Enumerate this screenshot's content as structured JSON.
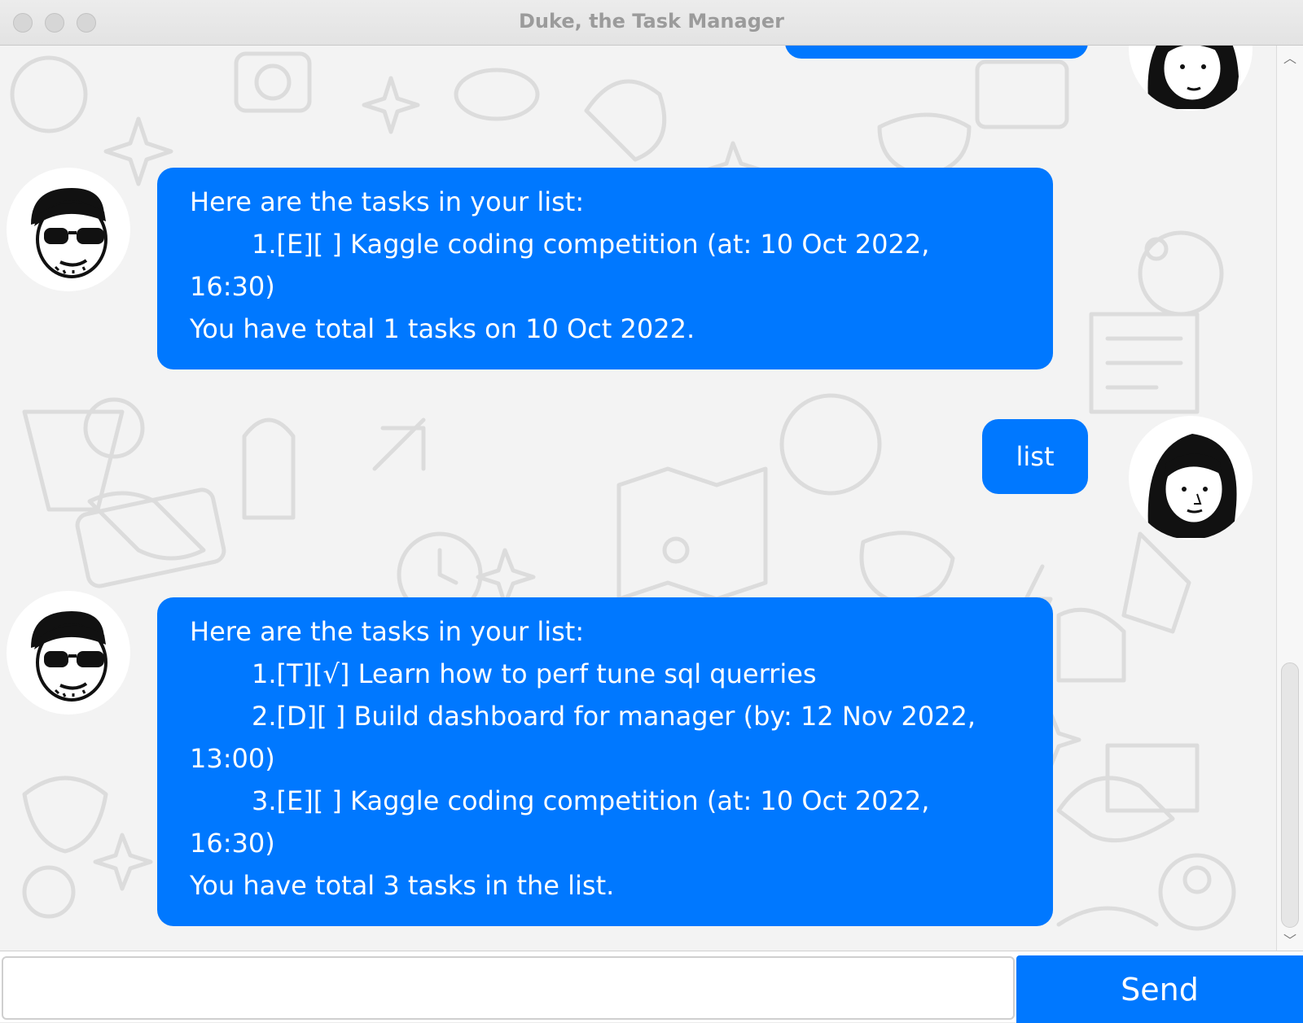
{
  "window": {
    "title": "Duke, the Task Manager"
  },
  "colors": {
    "accent": "#0078ff",
    "bubble_text": "#ffffff",
    "background": "#f3f3f3"
  },
  "messages": [
    {
      "from": "user",
      "text": ""
    },
    {
      "from": "duke",
      "lines": [
        "Here are the tasks in your list:",
        "1.[E][ ] Kaggle coding competition (at: 10 Oct 2022,",
        "16:30)",
        "You have total 1 tasks on 10 Oct 2022."
      ]
    },
    {
      "from": "user",
      "text": "list"
    },
    {
      "from": "duke",
      "lines": [
        "Here are the tasks in your list:",
        "1.[T][√] Learn how to perf tune sql querries",
        "2.[D][ ] Build dashboard for manager (by: 12 Nov 2022,",
        "13:00)",
        "3.[E][ ] Kaggle coding competition (at: 10 Oct 2022,",
        "16:30)",
        "You have total 3 tasks in the list."
      ]
    }
  ],
  "input": {
    "value": "",
    "placeholder": ""
  },
  "send": {
    "label": "Send"
  }
}
